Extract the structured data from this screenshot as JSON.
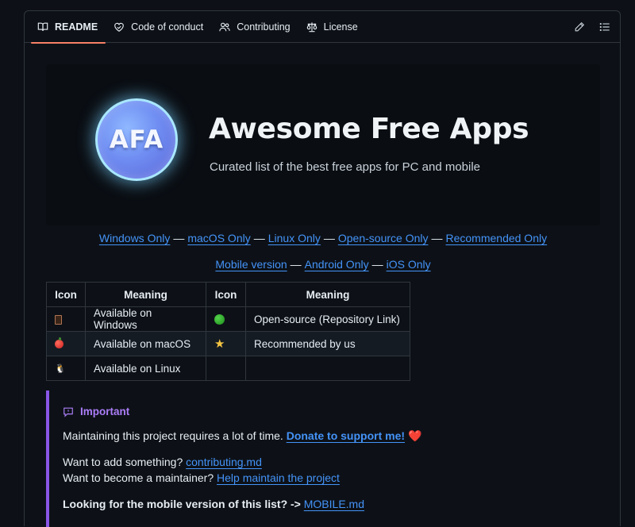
{
  "tabs": [
    {
      "label": "README",
      "icon": "book-icon",
      "active": true
    },
    {
      "label": "Code of conduct",
      "icon": "code-of-conduct-icon"
    },
    {
      "label": "Contributing",
      "icon": "people-icon"
    },
    {
      "label": "License",
      "icon": "law-icon"
    }
  ],
  "actions": {
    "edit_icon": "pencil-icon",
    "outline_icon": "list-icon"
  },
  "hero": {
    "logo_text": "AFA",
    "title": "Awesome Free Apps",
    "subtitle": "Curated list of the best free apps for PC and mobile"
  },
  "links_row1": [
    "Windows Only",
    "macOS Only",
    "Linux Only",
    "Open-source Only",
    "Recommended Only"
  ],
  "links_row2": [
    "Mobile version",
    "Android Only",
    "iOS Only"
  ],
  "separator": "—",
  "legend": {
    "headers": [
      "Icon",
      "Meaning",
      "Icon",
      "Meaning"
    ],
    "rows": [
      {
        "meaning1": "Available on Windows",
        "meaning2": "Open-source (Repository Link)"
      },
      {
        "meaning1": "Available on macOS",
        "meaning2": "Recommended by us"
      },
      {
        "meaning1": "Available on Linux",
        "meaning2": ""
      }
    ],
    "icons": {
      "windows": "door-icon",
      "macos": "apple-icon",
      "linux": "penguin-icon",
      "open_source": "green-circle-icon",
      "recommended": "star-icon"
    }
  },
  "alert": {
    "title": "Important",
    "line1_text": "Maintaining this project requires a lot of time. ",
    "line1_link": "Donate to support me!",
    "line1_heart": "❤️",
    "line2_text": "Want to add something? ",
    "line2_link": "contributing.md",
    "line3_text": "Want to become a maintainer? ",
    "line3_link": "Help maintain the project",
    "line4_text": "Looking for the mobile version of this list? -> ",
    "line4_link": "MOBILE.md"
  },
  "colors": {
    "accent_link": "#4493f8",
    "tab_underline": "#f78166",
    "alert_purple": "#8957e5"
  }
}
